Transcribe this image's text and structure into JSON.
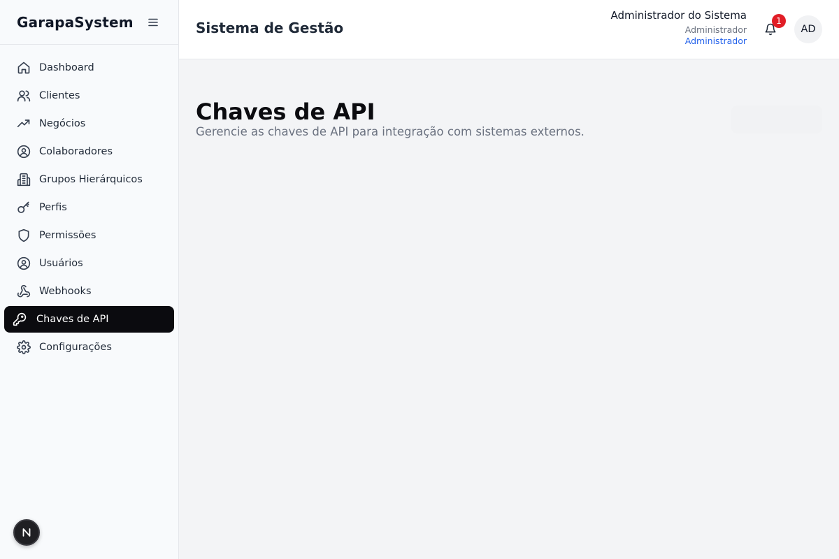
{
  "sidebar": {
    "brand": "GarapaSystem",
    "items": [
      {
        "label": "Dashboard",
        "icon": "home-icon"
      },
      {
        "label": "Clientes",
        "icon": "users-icon"
      },
      {
        "label": "Negócios",
        "icon": "trending-up-icon"
      },
      {
        "label": "Colaboradores",
        "icon": "user-circle-icon"
      },
      {
        "label": "Grupos Hierárquicos",
        "icon": "building-icon"
      },
      {
        "label": "Perfis",
        "icon": "key-icon"
      },
      {
        "label": "Permissões",
        "icon": "shield-icon"
      },
      {
        "label": "Usuários",
        "icon": "user-circle-icon"
      },
      {
        "label": "Webhooks",
        "icon": "webhook-icon"
      },
      {
        "label": "Chaves de API",
        "icon": "key-round-icon",
        "active": true
      },
      {
        "label": "Configurações",
        "icon": "gear-icon"
      }
    ],
    "dev_badge": "N"
  },
  "header": {
    "title": "Sistema de Gestão",
    "user": {
      "name": "Administrador do Sistema",
      "role": "Administrador",
      "profile": "Administrador"
    },
    "notifications": "1",
    "avatar_initials": "AD"
  },
  "main": {
    "title": "Chaves de API",
    "subtitle": "Gerencie as chaves de API para integração com sistemas externos."
  },
  "colors": {
    "active_bg": "#0b0b0f",
    "badge_red": "#e11d26",
    "link_blue": "#2563eb"
  }
}
